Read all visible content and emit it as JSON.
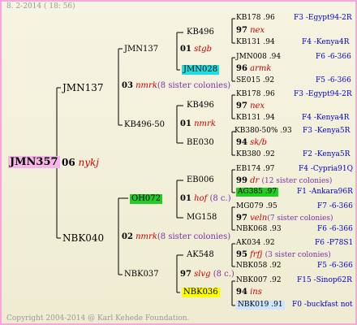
{
  "header": {
    "date": "8. 2-2014 ( 18: 56)"
  },
  "footer": {
    "copyright": "Copyright 2004-2014 @ Karl Kehede Foundation."
  },
  "colors": {
    "root_bg": "#f7b6ea",
    "oh_bg": "#22cc22",
    "jmn_bg": "#22dddd",
    "nbk_bg": "#ffff00",
    "ag_bg": "#22cc22",
    "nbk019_bg": "#cde5ff",
    "border": "#f7a8d8"
  },
  "root": {
    "id": "JMN357",
    "gen": "06",
    "label": "nykj"
  },
  "g1": {
    "top": "JMN137",
    "bottom": "NBK040",
    "top_info": {
      "gen": "03",
      "label": "nmrk",
      "extra": "(8 sister colonies)"
    },
    "bottom_info": {
      "gen": "02",
      "label": "nmrk",
      "extra": "(8 sister colonies)"
    }
  },
  "g2": {
    "a": "JMN137",
    "b": "KB496-50",
    "c": "OH072",
    "d": "NBK037",
    "a_info": {
      "gen": "01",
      "label": "stgb"
    },
    "b_info": {
      "gen": "01",
      "label": "nmrk"
    },
    "c_info": {
      "gen": "01",
      "label": "hof",
      "extra": "(8 c.)"
    },
    "d_info": {
      "gen": "97",
      "label": "slvg",
      "extra": "(8 c.)"
    }
  },
  "g3": [
    "KB496",
    "JMN028",
    "KB496",
    "BE030",
    "EB006",
    "MG158",
    "AK548",
    "NBK036"
  ],
  "g4": [
    {
      "top": "KB178 .96",
      "top_src": "F3 -Egypt94-2R",
      "mid_gen": "97",
      "mid_label": "nex",
      "bot": "KB131 .94",
      "bot_src": "F4 -Kenya4R"
    },
    {
      "top": "JMN008 .94",
      "top_src": "F6 -6-366",
      "mid_gen": "96",
      "mid_label": "armk",
      "bot": "SE015 .92",
      "bot_src": "F5 -6-366"
    },
    {
      "top": "KB178 .96",
      "top_src": "F3 -Egypt94-2R",
      "mid_gen": "97",
      "mid_label": "nex",
      "bot": "KB131 .94",
      "bot_src": "F4 -Kenya4R"
    },
    {
      "top": "KB380-50% .93",
      "top_src": "F3 -Kenya5R",
      "mid_gen": "94",
      "mid_label": "sk/b",
      "bot": "KB380 .92",
      "bot_src": "F2 -Kenya5R"
    },
    {
      "top": "EB174 .97",
      "top_src": "F4 -Cypria91Q",
      "mid_gen": "99",
      "mid_label": "dr",
      "mid_extra": "(12 sister colonies)",
      "bot": "AG385 .97",
      "bot_src": "F1 -Ankara96R"
    },
    {
      "top": "MG079 .95",
      "top_src": "F7 -6-366",
      "mid_gen": "97",
      "mid_label": "veln",
      "mid_extra": "(7 sister colonies)",
      "bot": "NBK068 .93",
      "bot_src": "F6 -6-366"
    },
    {
      "top": "AK034 .92",
      "top_src": "F6 -P78S1",
      "mid_gen": "95",
      "mid_label": "frfj",
      "mid_extra": "(3 sister colonies)",
      "bot": "NBK058 .92",
      "bot_src": "F5 -6-366"
    },
    {
      "top": "NBK007 .92",
      "top_src": "F15 -Sinop62R",
      "mid_gen": "94",
      "mid_label": "ins",
      "bot": "NBK019 .91",
      "bot_src": "F0 -buckfast not"
    }
  ]
}
